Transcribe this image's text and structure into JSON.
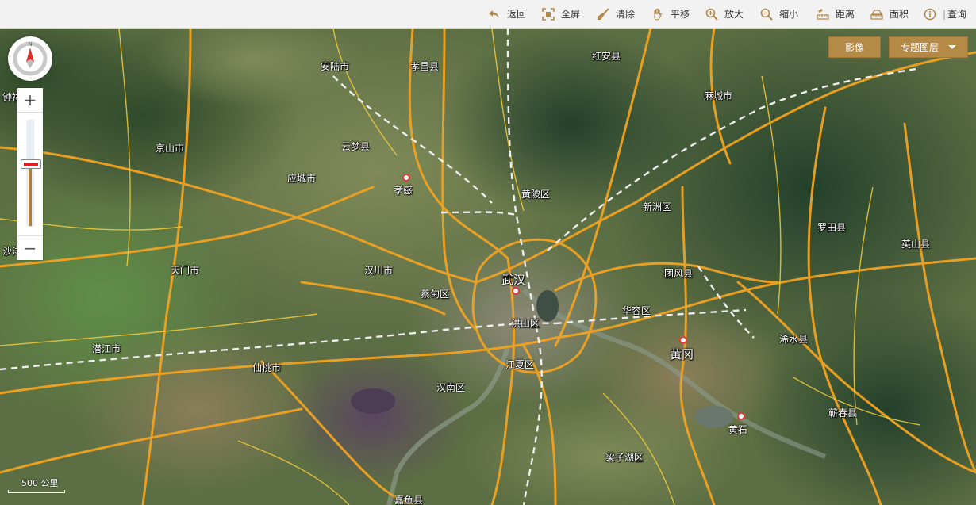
{
  "toolbar": {
    "tools": [
      {
        "label": "返回",
        "icon": "back-arrow-icon"
      },
      {
        "label": "全屏",
        "icon": "fullscreen-icon"
      },
      {
        "label": "清除",
        "icon": "broom-icon"
      },
      {
        "label": "平移",
        "icon": "hand-pan-icon"
      },
      {
        "label": "放大",
        "icon": "zoom-in-icon"
      },
      {
        "label": "缩小",
        "icon": "zoom-out-icon"
      },
      {
        "label": "距离",
        "icon": "ruler-distance-icon"
      },
      {
        "label": "面积",
        "icon": "area-icon"
      },
      {
        "label": "查询",
        "icon": "info-icon"
      }
    ]
  },
  "layer_buttons": {
    "imagery": "影像",
    "thematic": "专题图层"
  },
  "zoom": {
    "in": "+",
    "out": "−"
  },
  "compass_label": "N",
  "scale_bar": "500 公里",
  "place_labels": {
    "zhongxiang": "钟祥",
    "anlu": "安陆市",
    "xiaochang": "孝昌县",
    "hongan": "红安县",
    "macheng": "麻城市",
    "jingshan": "京山市",
    "yunmeng": "云梦县",
    "yingcheng": "应城市",
    "xiaogan": "孝感",
    "huangpi": "黄陂区",
    "xinzhou": "新洲区",
    "luotian": "罗田县",
    "yingshan": "英山县",
    "shayang": "沙洋",
    "tianmen": "天门市",
    "hanchuan": "汉川市",
    "wuhan": "武汉",
    "tuanfeng": "团风县",
    "caidian": "蔡甸区",
    "huarong": "华容区",
    "hongshan": "洪山区",
    "xishui": "浠水县",
    "huanggang": "黄冈",
    "qianjiang": "潜江市",
    "xiantao": "仙桃市",
    "jiangxia": "江夏区",
    "hannan": "汉南区",
    "qichun": "蕲春县",
    "huangshi": "黄石",
    "liangzihu": "梁子湖区",
    "jiayu": "嘉鱼县"
  }
}
